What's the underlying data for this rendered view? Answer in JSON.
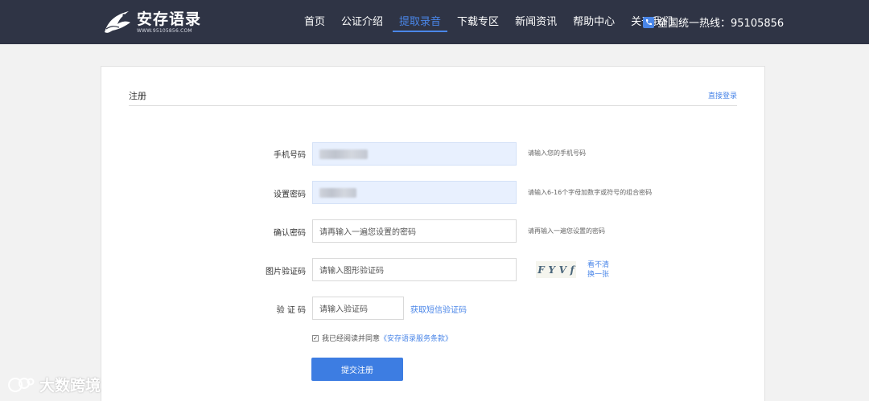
{
  "header": {
    "logo_name": "安存语录",
    "logo_url": "WWW.95105856.COM",
    "nav": [
      "首页",
      "公证介绍",
      "提取录音",
      "下载专区",
      "新闻资讯",
      "帮助中心",
      "关于我们"
    ],
    "active_index": 2,
    "hotline": "全国统一热线：95105856"
  },
  "panel": {
    "title": "注册",
    "login_link": "直接登录"
  },
  "form": {
    "phone_label": "手机号码",
    "phone_hint": "请输入您的手机号码",
    "password_label": "设置密码",
    "password_hint": "请输入6-16个字母加数字或符号的组合密码",
    "confirm_label": "确认密码",
    "confirm_placeholder": "请再输入一遍您设置的密码",
    "confirm_hint": "请再输入一遍您设置的密码",
    "image_code_label": "图片验证码",
    "image_code_placeholder": "请输入图形验证码",
    "captcha_chars": [
      "F",
      "Y",
      "V",
      "f"
    ],
    "refresh_line1": "看不清",
    "refresh_line2": "换一张",
    "sms_label": "验 证 码",
    "sms_placeholder": "请输入验证码",
    "sms_link": "获取短信验证码",
    "agree_text": "我已经阅读并同意",
    "agree_terms": "《安存语录服务条款》",
    "submit": "提交注册"
  },
  "watermark": "大数跨境",
  "colors": {
    "topbar": "#2f3445",
    "accent": "#4a86e8",
    "button": "#3d7de2",
    "filled_field": "#e8f0fe"
  }
}
